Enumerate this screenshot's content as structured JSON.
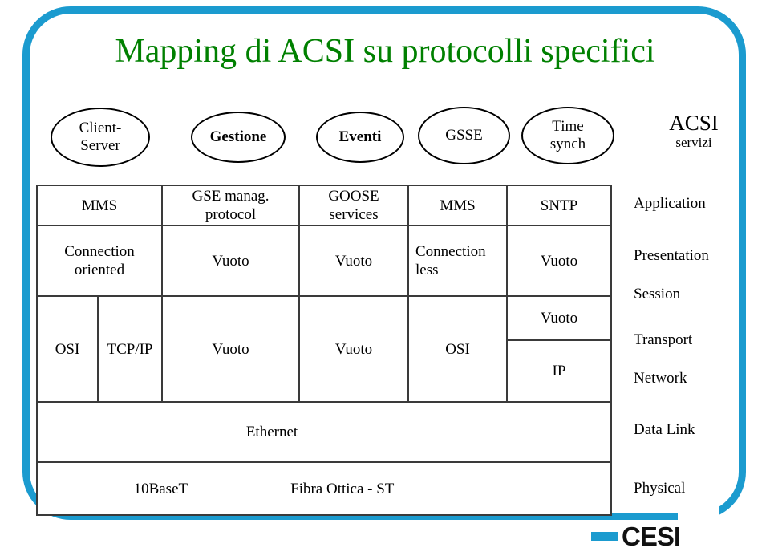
{
  "slide": {
    "title": "Mapping di ACSI su protocolli specifici",
    "title_color": "#008000",
    "frame_color": "#1b9bcf"
  },
  "service_bubbles": [
    {
      "label": "Client-\nServer",
      "bold": false
    },
    {
      "label": "Gestione",
      "bold": true
    },
    {
      "label": "Eventi",
      "bold": true
    },
    {
      "label": "GSSE",
      "bold": false
    },
    {
      "label": "Time\nsynch",
      "bold": false
    }
  ],
  "acsi_header": {
    "title": "ACSI",
    "subtitle": "servizi"
  },
  "layer_labels": [
    "Application",
    "Presentation",
    "Session",
    "Transport",
    "Network",
    "Data Link",
    "Physical"
  ],
  "stack_table": {
    "row_application": [
      "MMS",
      "GSE manag.\nprotocol",
      "GOOSE\nservices",
      "MMS",
      "SNTP"
    ],
    "row_presentation_session": [
      "Connection\noriented",
      "Vuoto",
      "Vuoto",
      "Connection\nless",
      "Vuoto"
    ],
    "row_transport_network": {
      "col1_a": "OSI",
      "col1_b": "TCP/IP",
      "col2": "Vuoto",
      "col3": "Vuoto",
      "col4": "OSI",
      "col5_transport": "Vuoto",
      "col5_network": "IP"
    },
    "row_datalink": "Ethernet",
    "row_physical": [
      "10BaseT",
      "Fibra Ottica - ST"
    ]
  },
  "logo": {
    "word": "CESI",
    "dash_color": "#1b9bcf"
  }
}
